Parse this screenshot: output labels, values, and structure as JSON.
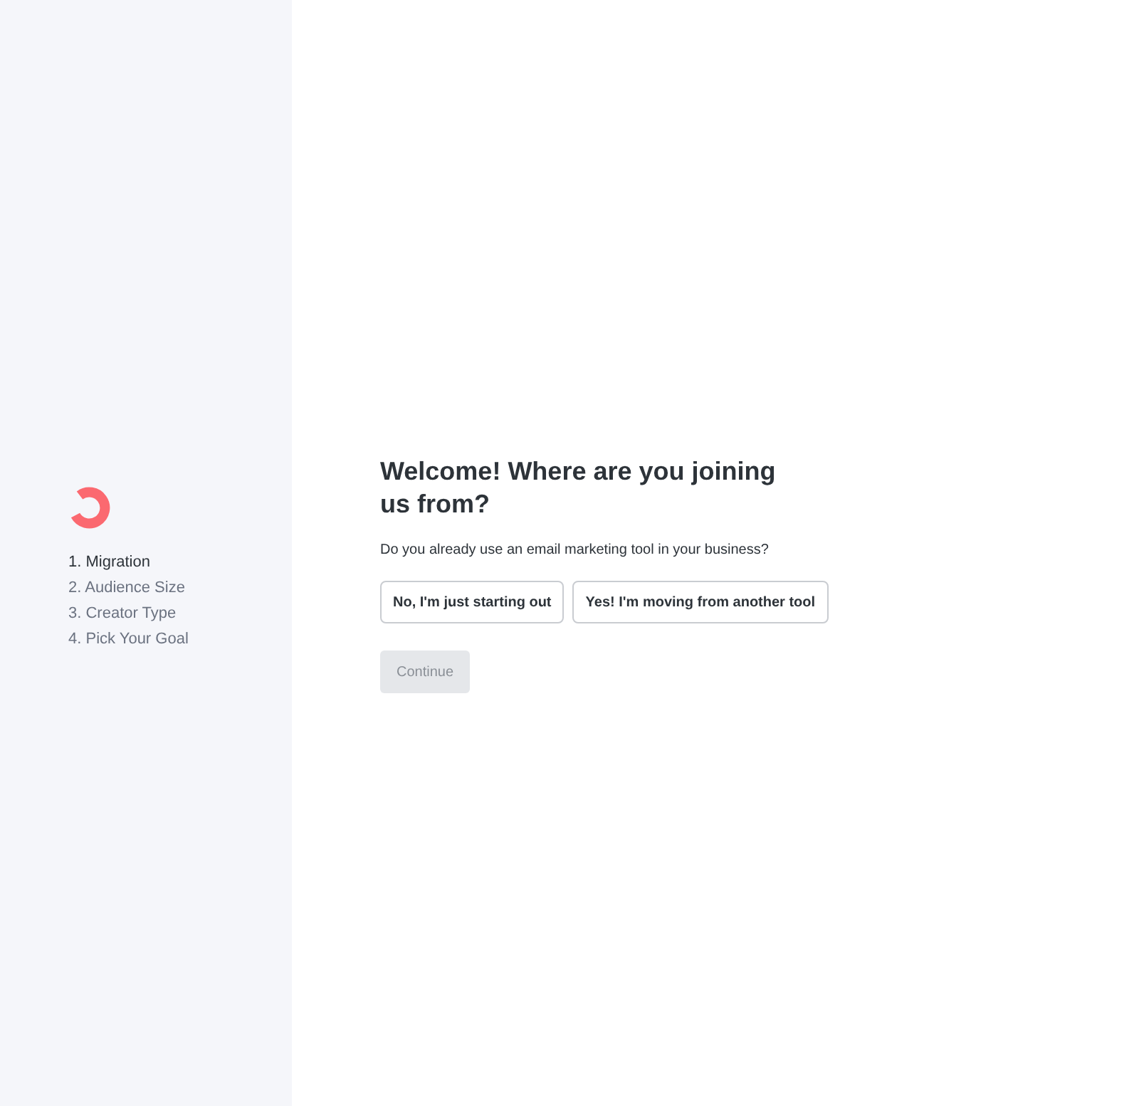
{
  "sidebar": {
    "steps": [
      {
        "label": "1. Migration",
        "selected": true
      },
      {
        "label": "2. Audience Size",
        "selected": false
      },
      {
        "label": "3. Creator Type",
        "selected": false
      },
      {
        "label": "4. Pick Your Goal",
        "selected": false
      }
    ]
  },
  "main": {
    "title": "Welcome! Where are you joining us from?",
    "question": "Do you already use an email marketing tool in your business?",
    "options": [
      {
        "label": "No, I'm just starting out",
        "selected": false
      },
      {
        "label": "Yes! I'm moving from another tool",
        "selected": false
      }
    ],
    "continue_button": {
      "label": "Continue",
      "disabled": true
    }
  }
}
